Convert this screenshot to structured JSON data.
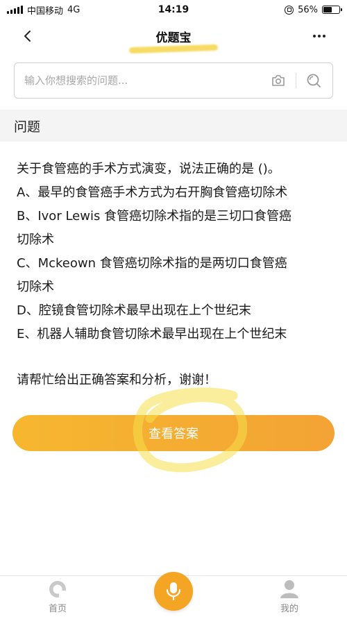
{
  "status_bar": {
    "carrier": "中国移动",
    "network": "4G",
    "time": "14:19",
    "battery_percent": "56%",
    "battery_level": 0.56
  },
  "nav": {
    "title": "优题宝"
  },
  "search": {
    "placeholder": "输入你想搜索的问题..."
  },
  "section": {
    "title": "问题"
  },
  "question": {
    "stem": "关于食管癌的手术方式演变，说法正确的是 ()。",
    "options": [
      "A、最早的食管癌手术方式为右开胸食管癌切除术",
      "B、Ivor Lewis 食管癌切除术指的是三切口食管癌",
      "切除术",
      "C、Mckeown 食管癌切除术指的是两切口食管癌",
      "切除术",
      "D、腔镜食管切除术最早出现在上个世纪末",
      "E、机器人辅助食管切除术最早出现在上个世纪末"
    ],
    "request": "请帮忙给出正确答案和分析，谢谢！"
  },
  "answer_button": {
    "label": "查看答案"
  },
  "tab_bar": {
    "home_label": "首页",
    "mine_label": "我的"
  },
  "colors": {
    "accent": "#f5a524",
    "highlight": "#f6d54a"
  }
}
